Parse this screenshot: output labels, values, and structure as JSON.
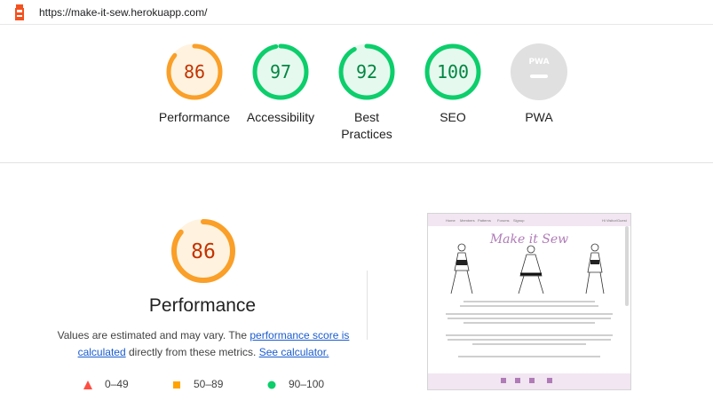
{
  "header": {
    "url": "https://make-it-sew.herokuapp.com/"
  },
  "categories": [
    {
      "label": "Performance",
      "score": "86",
      "value": 86,
      "color": "#fa9f28",
      "bg": "#fff3e0",
      "text": "#c33300"
    },
    {
      "label": "Accessibility",
      "score": "97",
      "value": 97,
      "color": "#0cce6b",
      "bg": "#e6f9ee",
      "text": "#018642"
    },
    {
      "label_line1": "Best",
      "label_line2": "Practices",
      "score": "92",
      "value": 92,
      "color": "#0cce6b",
      "bg": "#e6f9ee",
      "text": "#018642"
    },
    {
      "label": "SEO",
      "score": "100",
      "value": 100,
      "color": "#0cce6b",
      "bg": "#e6f9ee",
      "text": "#018642"
    },
    {
      "label": "PWA",
      "badge": "PWA"
    }
  ],
  "performance": {
    "score": "86",
    "value": 86,
    "title": "Performance",
    "desc_before": "Values are estimated and may vary. The ",
    "link_score": "performance score is calculated",
    "desc_middle": " directly from these metrics. ",
    "link_calc": "See calculator."
  },
  "legend": [
    {
      "range": "0–49",
      "color": "#ff4e42",
      "shape": "triangle"
    },
    {
      "range": "50–89",
      "color": "#ffa400",
      "shape": "square"
    },
    {
      "range": "90–100",
      "color": "#0cce6b",
      "shape": "circle"
    }
  ],
  "screenshot": {
    "title": "Make it Sew",
    "nav": [
      "Home",
      "Members",
      "Patterns",
      "Forums",
      "Signup"
    ],
    "nav_right": "Hi Visitor/Guest"
  },
  "colors": {
    "link": "#1a5ccf"
  }
}
